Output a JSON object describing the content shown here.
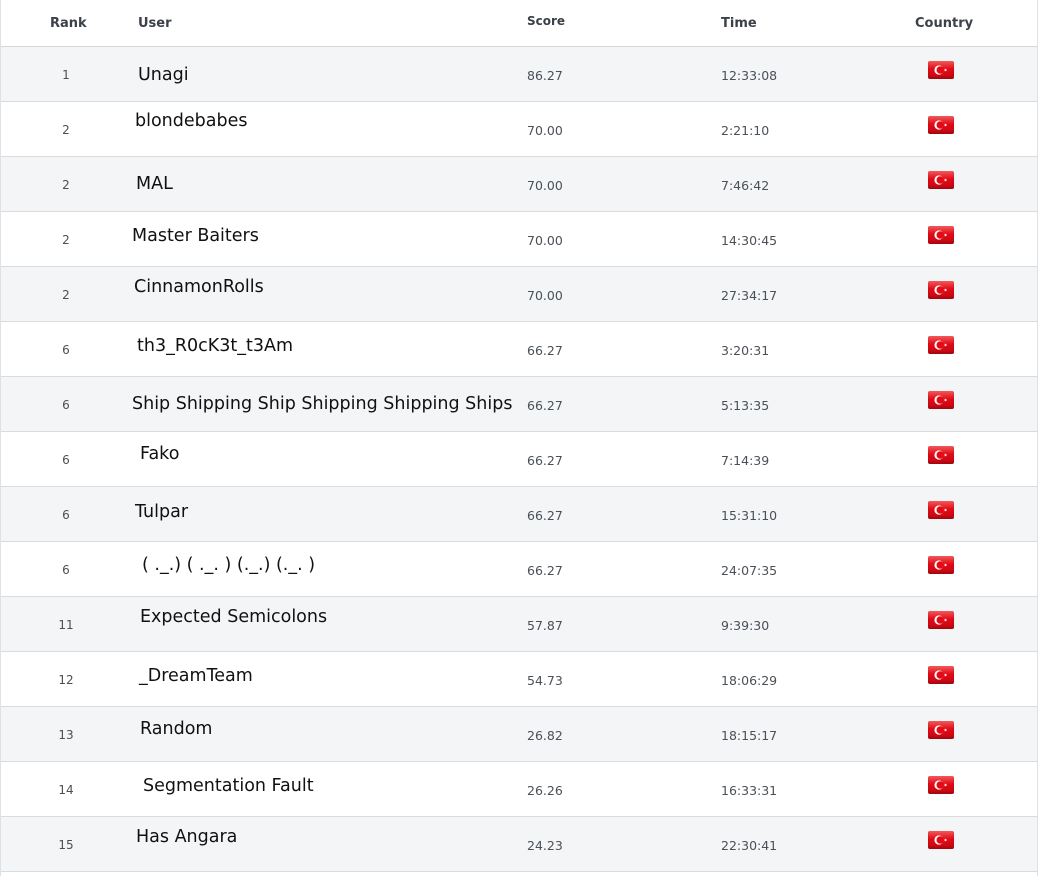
{
  "table": {
    "headers": {
      "rank": "Rank",
      "user": "User",
      "score": "Score",
      "time": "Time",
      "country": "Country"
    },
    "rows": [
      {
        "rank": "1",
        "user": "Unagi",
        "score": "86.27",
        "time": "12:33:08",
        "country_icon": "turkey-flag-icon"
      },
      {
        "rank": "2",
        "user": "blondebabes",
        "score": "70.00",
        "time": "2:21:10",
        "country_icon": "turkey-flag-icon"
      },
      {
        "rank": "2",
        "user": "MAL",
        "score": "70.00",
        "time": "7:46:42",
        "country_icon": "turkey-flag-icon"
      },
      {
        "rank": "2",
        "user": "Master Baiters",
        "score": "70.00",
        "time": "14:30:45",
        "country_icon": "turkey-flag-icon"
      },
      {
        "rank": "2",
        "user": "CinnamonRolls",
        "score": "70.00",
        "time": "27:34:17",
        "country_icon": "turkey-flag-icon"
      },
      {
        "rank": "6",
        "user": "th3_R0cK3t_t3Am",
        "score": "66.27",
        "time": "3:20:31",
        "country_icon": "turkey-flag-icon"
      },
      {
        "rank": "6",
        "user": "Ship Shipping Ship Shipping Shipping Ships",
        "score": "66.27",
        "time": "5:13:35",
        "country_icon": "turkey-flag-icon"
      },
      {
        "rank": "6",
        "user": "Fako",
        "score": "66.27",
        "time": "7:14:39",
        "country_icon": "turkey-flag-icon"
      },
      {
        "rank": "6",
        "user": "Tulpar",
        "score": "66.27",
        "time": "15:31:10",
        "country_icon": "turkey-flag-icon"
      },
      {
        "rank": "6",
        "user": "( ._.) ( ._. ) (._.) (._. )",
        "score": "66.27",
        "time": "24:07:35",
        "country_icon": "turkey-flag-icon"
      },
      {
        "rank": "11",
        "user": "Expected Semicolons",
        "score": "57.87",
        "time": "9:39:30",
        "country_icon": "turkey-flag-icon"
      },
      {
        "rank": "12",
        "user": "_DreamTeam",
        "score": "54.73",
        "time": "18:06:29",
        "country_icon": "turkey-flag-icon"
      },
      {
        "rank": "13",
        "user": "Random",
        "score": "26.82",
        "time": "18:15:17",
        "country_icon": "turkey-flag-icon"
      },
      {
        "rank": "14",
        "user": "Segmentation Fault",
        "score": "26.26",
        "time": "16:33:31",
        "country_icon": "turkey-flag-icon"
      },
      {
        "rank": "15",
        "user": "Has Angara",
        "score": "24.23",
        "time": "22:30:41",
        "country_icon": "turkey-flag-icon"
      }
    ]
  },
  "colors": {
    "row_stripe": "#f3f5f7",
    "flag_red": "#e30a17"
  }
}
